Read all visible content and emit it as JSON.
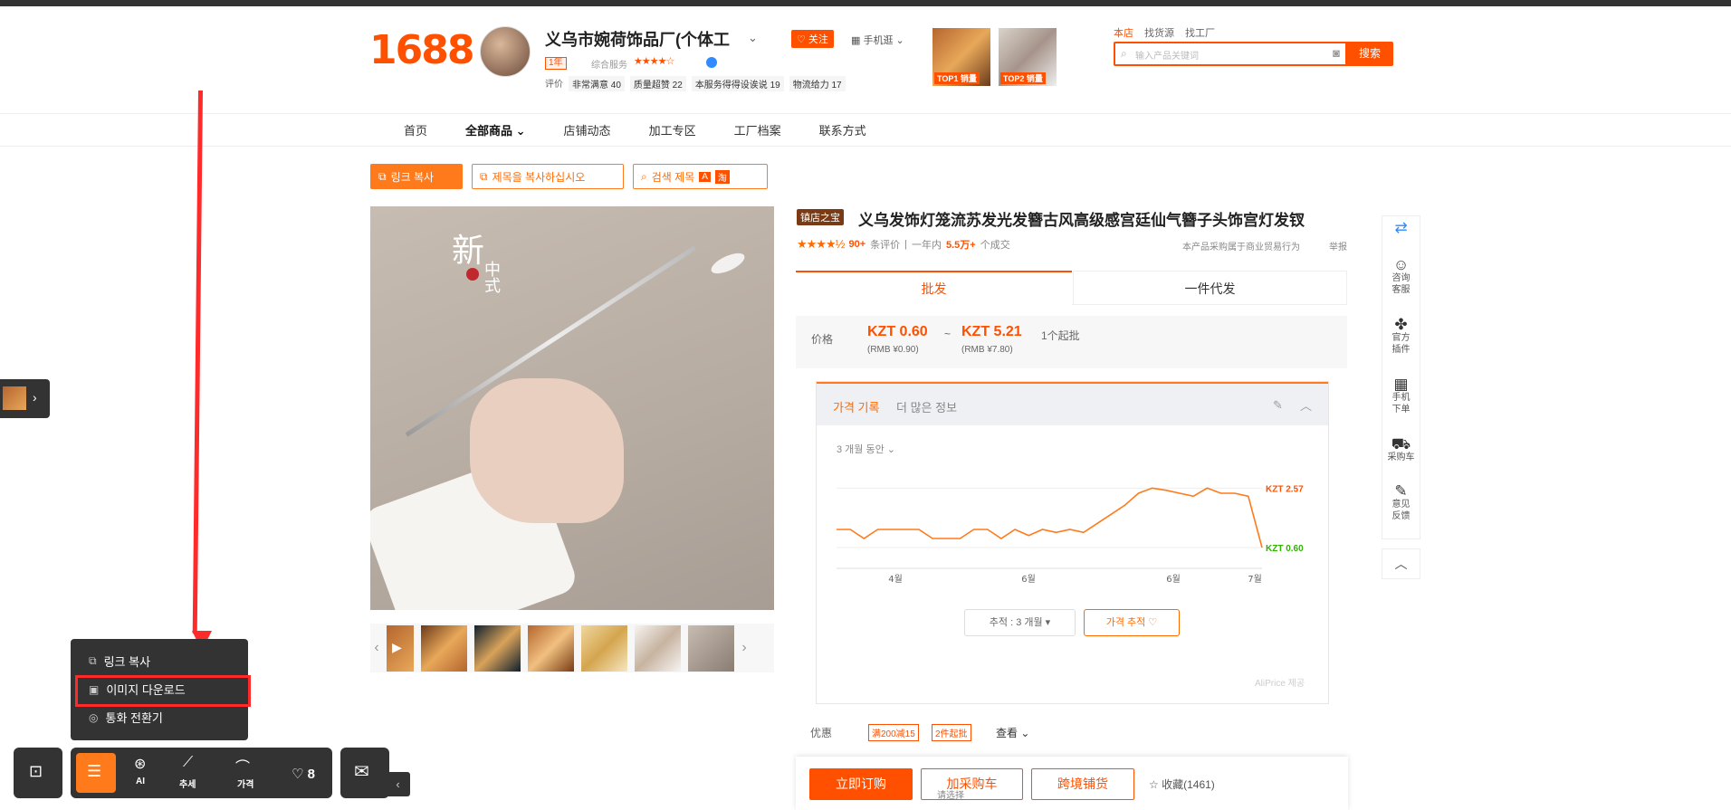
{
  "header": {
    "logo": "1688",
    "shop_name": "义乌市婉荷饰品厂(个体工",
    "year_badge": "1年",
    "service_label": "综合服务",
    "service_stars": "★★★★☆",
    "follow_label": "♡ 关注",
    "mobile_label": "手机逛",
    "ratings": [
      {
        "label": "评价",
        "value": ""
      },
      {
        "label": "非常满意 40",
        "value": ""
      },
      {
        "label": "质量超赞 22",
        "value": ""
      },
      {
        "label": "本服务得得设诶说 19",
        "value": ""
      },
      {
        "label": "物流给力 17",
        "value": ""
      }
    ],
    "top1_label": "TOP1 销量",
    "top2_label": "TOP2 销量",
    "search_tabs": [
      "本店",
      "找货源",
      "找工厂"
    ],
    "search_placeholder": "输入产品关键词",
    "search_button": "搜索"
  },
  "nav": {
    "items": [
      "首页",
      "全部商品",
      "店铺动态",
      "加工专区",
      "工厂档案",
      "联系方式"
    ]
  },
  "ext_buttons": {
    "copy_link": "링크 복사",
    "copy_title": "제목을 복사하십시오",
    "search_title": "검색 제목"
  },
  "product": {
    "shop_tag": "镇店之宝",
    "title": "义乌发饰灯笼流苏发光发簪古风高级感宫廷仙气簪子头饰宫灯发钗",
    "stars": "★★★★½",
    "review_count": "90+",
    "review_label": "条评价",
    "year_label": "一年内",
    "sold": "5.5万+",
    "sold_label": "个成交",
    "note": "本产品采购属于商业贸易行为",
    "report": "举报",
    "image_text_big": "新",
    "image_text_sub": "中式",
    "tabs": [
      "批发",
      "一件代发"
    ]
  },
  "price": {
    "label": "价格",
    "low": "KZT  0.60",
    "low_rmb": "(RMB ¥0.90)",
    "high": "KZT  5.21",
    "high_rmb": "(RMB ¥7.80)",
    "tilde": "~",
    "min_qty": "1个起批"
  },
  "price_history": {
    "tab_active": "가격 기록",
    "tab_other": "더 많은 정보",
    "period": "3 개월 동안 ⌄",
    "select_label": "추적 : 3 개월",
    "track_label": "가격 추적 ♡",
    "footer": "AliPrice 제공"
  },
  "chart_data": {
    "type": "line",
    "x": [
      "4월",
      "6월",
      "6월",
      "7월"
    ],
    "series": [
      {
        "values": [
          1.2,
          1.2,
          0.9,
          1.2,
          1.2,
          1.2,
          1.2,
          0.9,
          0.9,
          0.9,
          1.2,
          1.2,
          0.9,
          1.2,
          1.0,
          1.2,
          1.1,
          1.2,
          1.1,
          1.4,
          1.7,
          2.0,
          2.4,
          2.57,
          2.5,
          2.4,
          2.3,
          2.57,
          2.4,
          2.4,
          2.3,
          0.6
        ]
      }
    ],
    "max_label": "KZT 2.57",
    "min_label": "KZT 0.60",
    "ylim": [
      0,
      3
    ],
    "grid": true,
    "colors": {
      "line": "#ff7a1a",
      "max": "#ff5000",
      "min": "#2db300"
    }
  },
  "promotions": {
    "label": "优惠",
    "coupons": [
      "满200减15",
      "2件起批"
    ],
    "more": "查看"
  },
  "buy": {
    "buy_now": "立即订购",
    "add_cart": "加采购车",
    "cross": "跨境铺货",
    "collect": "收藏(1461)",
    "ship_note": "请选择"
  },
  "rail": {
    "items": [
      {
        "icon": "💬",
        "label": "咨询客服"
      },
      {
        "icon": "⚙",
        "label": "官方插件"
      },
      {
        "icon": "▦",
        "label": "手机下单"
      },
      {
        "icon": "🛒",
        "label": "采购车"
      },
      {
        "icon": "✎",
        "label": "意见反馈"
      }
    ],
    "top": "︿"
  },
  "context_menu": {
    "items": [
      "링크 복사",
      "이미지 다운로드",
      "통화 전환기"
    ]
  },
  "toolbar": {
    "ai": "AI",
    "trend": "추세",
    "price": "가격",
    "fav_count": "♡ 8"
  },
  "colors": {
    "accent": "#ff5000",
    "highlight": "#ff2b2b",
    "dark": "#333333"
  }
}
